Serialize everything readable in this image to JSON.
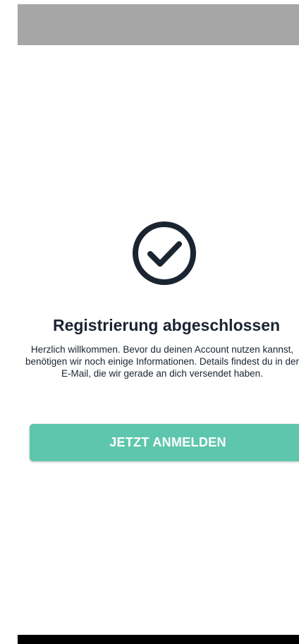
{
  "registration": {
    "icon": "check-circle-icon",
    "title": "Registrierung abgeschlossen",
    "message": "Herzlich willkommen. Bevor du deinen Account nutzen kannst, benötigen wir noch einige Informationen. Details findest du in der E-Mail, die wir gerade an dich versendet haben.",
    "button_label": "JETZT ANMELDEN"
  },
  "colors": {
    "status_bar": "#a6a6a6",
    "accent": "#5ec6ad",
    "text": "#1b2431",
    "nav_bar": "#000000"
  }
}
